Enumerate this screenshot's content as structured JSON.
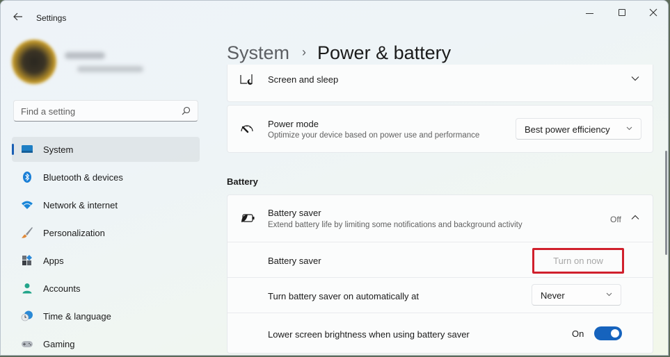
{
  "window": {
    "title": "Settings",
    "controls": {
      "minimize": "minimize",
      "maximize": "maximize",
      "close": "close"
    }
  },
  "profile": {
    "name": "",
    "email": ""
  },
  "search": {
    "placeholder": "Find a setting",
    "icon": "search-icon"
  },
  "sidebar": {
    "items": [
      {
        "label": "System",
        "icon": "system-display-icon",
        "active": true
      },
      {
        "label": "Bluetooth & devices",
        "icon": "bluetooth-icon"
      },
      {
        "label": "Network & internet",
        "icon": "wifi-icon"
      },
      {
        "label": "Personalization",
        "icon": "brush-icon"
      },
      {
        "label": "Apps",
        "icon": "apps-icon"
      },
      {
        "label": "Accounts",
        "icon": "account-icon"
      },
      {
        "label": "Time & language",
        "icon": "globe-clock-icon"
      },
      {
        "label": "Gaming",
        "icon": "gamepad-icon"
      }
    ]
  },
  "breadcrumb": {
    "parent": "System",
    "separator": "›",
    "current": "Power & battery"
  },
  "cards": {
    "screen_sleep": {
      "title": "Screen and sleep"
    },
    "power_mode": {
      "title": "Power mode",
      "subtitle": "Optimize your device based on power use and performance",
      "selected": "Best power efficiency"
    }
  },
  "battery": {
    "section_label": "Battery",
    "saver": {
      "title": "Battery saver",
      "subtitle": "Extend battery life by limiting some notifications and background activity",
      "status": "Off",
      "rows": {
        "turn_on": {
          "label": "Battery saver",
          "button": "Turn on now"
        },
        "auto": {
          "label": "Turn battery saver on automatically at",
          "selected": "Never"
        },
        "brightness": {
          "label": "Lower screen brightness when using battery saver",
          "state": "On",
          "toggled": true
        }
      }
    }
  },
  "colors": {
    "accent": "#1663bd",
    "highlight": "#d0202c"
  }
}
